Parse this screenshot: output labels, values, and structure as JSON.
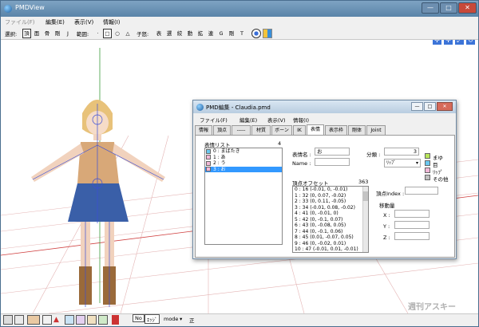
{
  "window": {
    "title": "PMDView",
    "controls": [
      "—",
      "□",
      "✕"
    ]
  },
  "menu": {
    "items": [
      "ファイル(F)",
      "編集(E)",
      "表示(V)",
      "情報(I)"
    ]
  },
  "toolbar": {
    "select_label": "選択:",
    "select_buttons": [
      "頂",
      "面",
      "骨",
      "剛",
      "J"
    ],
    "range_label": "範囲:",
    "range_buttons": [
      "·",
      "□",
      "○",
      "△"
    ],
    "sub_label": "子怒:",
    "sub_buttons": [
      "表",
      "選",
      "絞",
      "動",
      "拡",
      "連",
      "G",
      "剛",
      "T"
    ]
  },
  "statusbar": {
    "mode_label": "mode",
    "buttons": [
      "No",
      "ｴｯｼﾞ"
    ],
    "right_text": "正"
  },
  "watermark": "週刊アスキー",
  "dialog": {
    "title": "PMD編集 - Claudia.pmd",
    "menu": [
      "ファイル(F)",
      "編集(E)",
      "表示(V)",
      "情報(I)"
    ],
    "tabs": [
      "情報",
      "頂点",
      "-----",
      "材質",
      "ボーン",
      "IK",
      "表情",
      "表示枠",
      "剛体",
      "Joint"
    ],
    "selected_tab": "表情",
    "morph_list_label": "表情リスト",
    "morph_count": "4",
    "morphs": [
      "0 : まばたき",
      "1 : あ",
      "2 : う",
      "3 : お"
    ],
    "morph_name_label": "表情名 :",
    "morph_name_value": "お",
    "name_label": "Name :",
    "name_value": "",
    "category_label": "分類 :",
    "category_value": "3",
    "category_select": "ﾘｯﾌﾟ",
    "categories": [
      {
        "label": "まゆ",
        "color": "#b8e65a"
      },
      {
        "label": "目",
        "color": "#6ac8f0"
      },
      {
        "label": "ﾘｯﾌﾟ",
        "color": "#f2b8d8"
      },
      {
        "label": "その他",
        "color": "#c0c0c0"
      }
    ],
    "offset_label": "頂点オフセット",
    "offset_count": "363",
    "offsets": [
      "0 : 16  (-0.01, 0, -0.01)",
      "1 : 32  (0, 0.07, -0.02)",
      "2 : 33  (0, 0.11, -0.05)",
      "3 : 34  (-0.01, 0.08, -0.02)",
      "4 : 41  (0, -0.01, 0)",
      "5 : 42  (0, -0.1, 0.07)",
      "6 : 43  (0, -0.08, 0.05)",
      "7 : 44  (0, -0.1, 0.06)",
      "8 : 45  (0.01, -0.07, 0.05)",
      "9 : 46  (0, -0.02, 0.01)",
      "10 : 47  (-0.01, 0.01, -0.01)"
    ],
    "vertex_index_label": "頂点Index :",
    "move_label": "移動量",
    "axes": [
      "X :",
      "Y :",
      "Z :"
    ]
  }
}
